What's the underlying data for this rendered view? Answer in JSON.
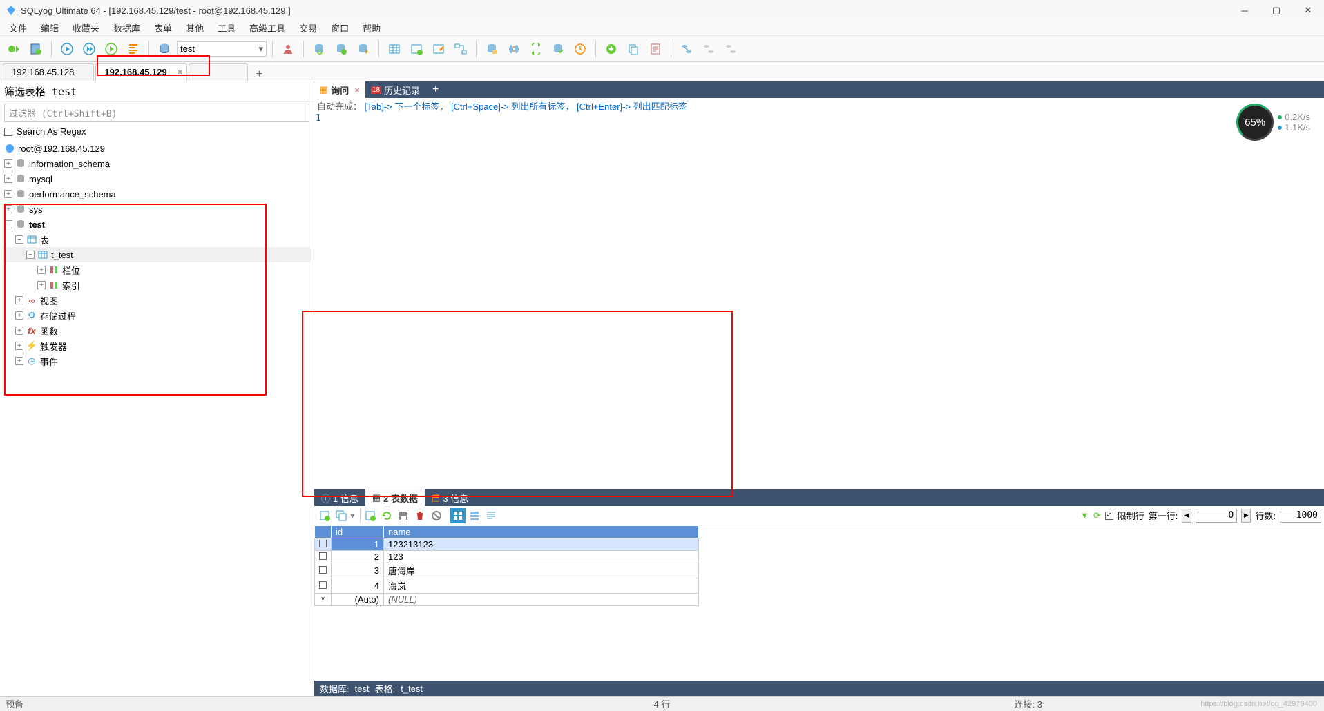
{
  "title": "SQLyog Ultimate 64 - [192.168.45.129/test - root@192.168.45.129 ]",
  "menu": [
    "文件",
    "编辑",
    "收藏夹",
    "数据库",
    "表单",
    "其他",
    "工具",
    "高级工具",
    "交易",
    "窗口",
    "帮助"
  ],
  "db_dropdown": "test",
  "conn_tabs": [
    {
      "label": "192.168.45.128",
      "active": false
    },
    {
      "label": "192.168.45.129",
      "active": true
    }
  ],
  "filter": {
    "title": "筛选表格 test",
    "placeholder": "过滤器 (Ctrl+Shift+B)",
    "regex_label": "Search As Regex"
  },
  "tree": {
    "root": "root@192.168.45.129",
    "dbs": [
      {
        "name": "information_schema",
        "open": false
      },
      {
        "name": "mysql",
        "open": false
      },
      {
        "name": "performance_schema",
        "open": false
      },
      {
        "name": "sys",
        "open": false
      }
    ],
    "active_db": "test",
    "tables_label": "表",
    "table": "t_test",
    "table_children": [
      "栏位",
      "索引"
    ],
    "other_nodes": [
      {
        "icon": "∞",
        "label": "视图",
        "color": "#c66"
      },
      {
        "icon": "⚙",
        "label": "存储过程",
        "color": "#39c"
      },
      {
        "icon": "fx",
        "label": "函数",
        "color": "#c33",
        "italic": true
      },
      {
        "icon": "⚡",
        "label": "触发器",
        "color": "#f80"
      },
      {
        "icon": "◷",
        "label": "事件",
        "color": "#39c"
      }
    ]
  },
  "query_tabs": [
    {
      "label": "询问",
      "active": true
    },
    {
      "label": "历史记录",
      "active": false
    }
  ],
  "autocomplete": {
    "prefix": "自动完成：",
    "items": [
      "[Tab]-> 下一个标签，",
      "[Ctrl+Space]-> 列出所有标签，",
      "[Ctrl+Enter]-> 列出匹配标签"
    ]
  },
  "gauge": {
    "pct": "65%",
    "up": "0.2K/s",
    "down": "1.1K/s"
  },
  "result_tabs": [
    {
      "label": "1 信息",
      "u": "1"
    },
    {
      "label": "2 表数据",
      "u": "2",
      "active": true
    },
    {
      "label": "3 信息",
      "u": "3"
    }
  ],
  "limit": {
    "label": "限制行",
    "first_label": "第一行:",
    "first": "0",
    "count_label": "行数:",
    "count": "1000"
  },
  "chart_data": {
    "type": "table",
    "columns": [
      "id",
      "name"
    ],
    "rows": [
      {
        "id": "1",
        "name": "123213123",
        "sel": true
      },
      {
        "id": "2",
        "name": "123"
      },
      {
        "id": "3",
        "name": "唐海岸"
      },
      {
        "id": "4",
        "name": "海岚"
      }
    ],
    "new_row": {
      "id": "(Auto)",
      "name": "(NULL)"
    }
  },
  "db_status": {
    "db_label": "数据库:",
    "db": "test",
    "table_label": "表格:",
    "table": "t_test"
  },
  "status": {
    "ready": "预备",
    "rows": "4 行",
    "conn": "连接: 3",
    "wm": "https://blog.csdn.net/qq_42979400"
  }
}
